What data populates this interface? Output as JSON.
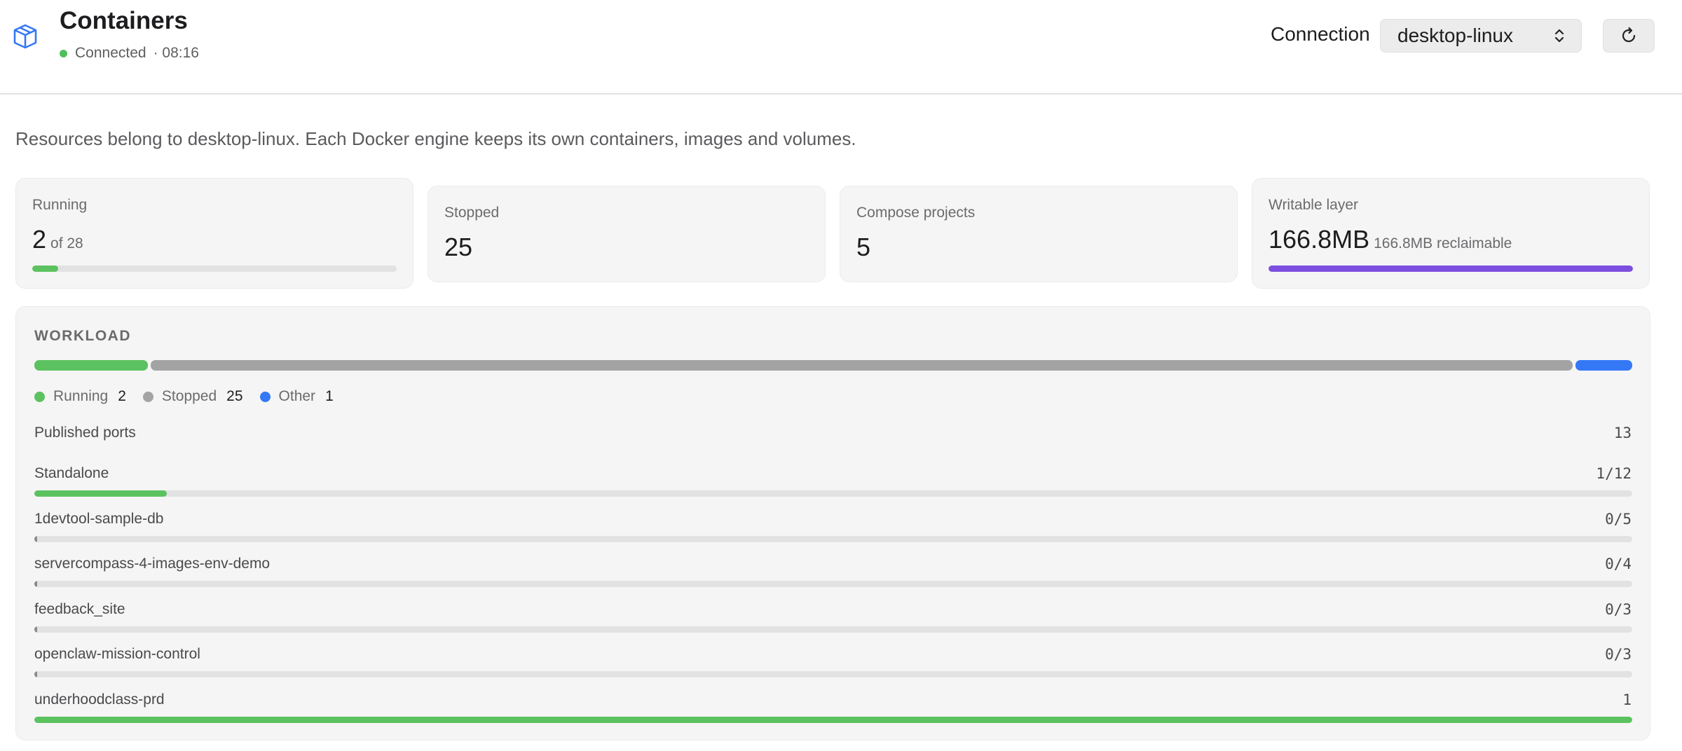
{
  "header": {
    "title": "Containers",
    "status": "Connected",
    "time": "· 08:16",
    "connection_label": "Connection",
    "connection_value": "desktop-linux",
    "icons": {
      "app": "container-box-icon",
      "refresh": "refresh-icon",
      "select": "chevron-updown-icon"
    }
  },
  "description": "Resources belong to desktop-linux. Each Docker engine keeps its own containers, images and volumes.",
  "cards": {
    "running": {
      "label": "Running",
      "value": "2",
      "sub": "of 28",
      "fraction": 0.071
    },
    "stopped": {
      "label": "Stopped",
      "value": "25"
    },
    "compose": {
      "label": "Compose projects",
      "value": "5"
    },
    "writable": {
      "label": "Writable layer",
      "value": "166.8MB",
      "sub": "166.8MB reclaimable",
      "fraction": 1.0
    }
  },
  "workload": {
    "title": "WORKLOAD",
    "segments": [
      {
        "name": "Running",
        "count": 2,
        "color": "#5cc25f"
      },
      {
        "name": "Stopped",
        "count": 25,
        "color": "#a3a3a3"
      },
      {
        "name": "Other",
        "count": 1,
        "color": "#3478f6"
      }
    ],
    "legend": [
      {
        "label": "Running",
        "count": "2",
        "color": "#5cc25f"
      },
      {
        "label": "Stopped",
        "count": "25",
        "color": "#a3a3a3"
      },
      {
        "label": "Other",
        "count": "1",
        "color": "#3478f6"
      }
    ],
    "published_ports_label": "Published ports",
    "published_ports_value": "13",
    "projects": [
      {
        "name": "Standalone",
        "count": "1/12",
        "fraction": 0.083,
        "color": "#5cc25f"
      },
      {
        "name": "1devtool-sample-db",
        "count": "0/5",
        "fraction": 0.0,
        "color": "#5cc25f"
      },
      {
        "name": "servercompass-4-images-env-demo",
        "count": "0/4",
        "fraction": 0.0,
        "color": "#5cc25f"
      },
      {
        "name": "feedback_site",
        "count": "0/3",
        "fraction": 0.0,
        "color": "#5cc25f"
      },
      {
        "name": "openclaw-mission-control",
        "count": "0/3",
        "fraction": 0.0,
        "color": "#5cc25f"
      },
      {
        "name": "underhoodclass-prd",
        "count": "1",
        "fraction": 1.0,
        "color": "#5cc25f"
      }
    ]
  },
  "colors": {
    "running": "#5cc25f",
    "writable": "#7d4fe0",
    "connected": "#4fbf5a"
  }
}
